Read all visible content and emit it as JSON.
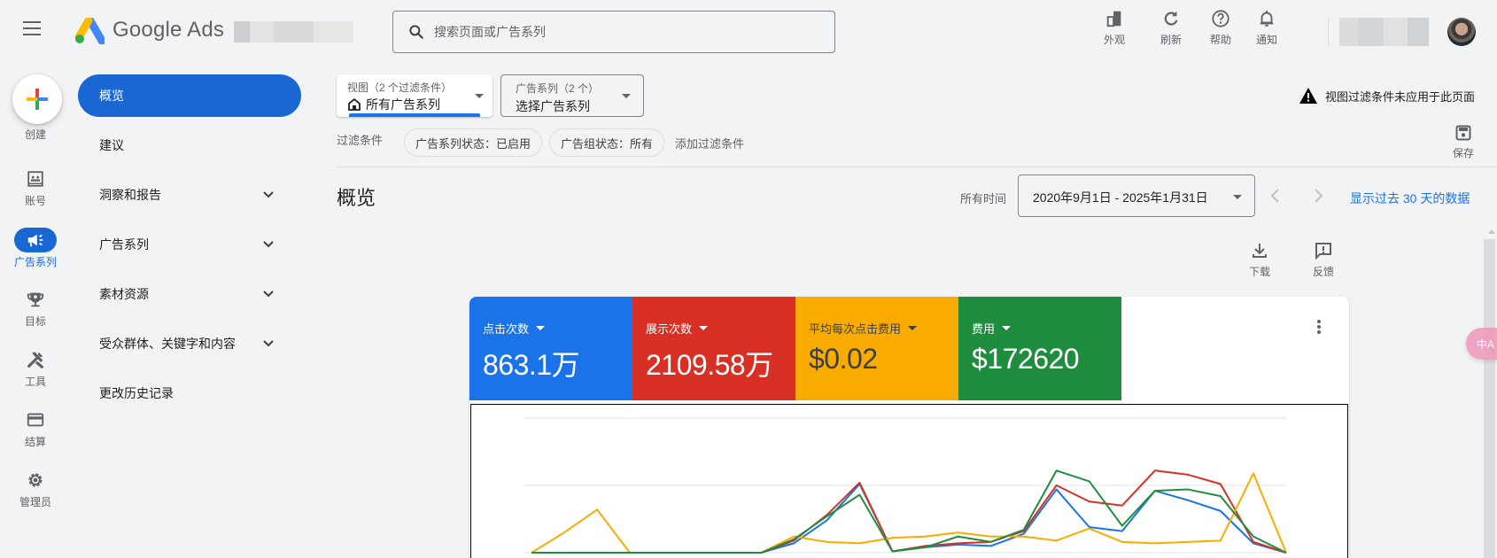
{
  "topbar": {
    "brand": "Google Ads",
    "search_placeholder": "搜索页面或广告系列",
    "actions": [
      {
        "icon": "appearance-icon",
        "label": "外观"
      },
      {
        "icon": "refresh-icon",
        "label": "刷新"
      },
      {
        "icon": "help-icon",
        "label": "帮助"
      },
      {
        "icon": "bell-icon",
        "label": "通知"
      }
    ]
  },
  "rail": {
    "create_label": "创建",
    "items": [
      {
        "icon": "account-icon",
        "label": "账号",
        "active": false
      },
      {
        "icon": "megaphone-icon",
        "label": "广告系列",
        "active": true
      },
      {
        "icon": "trophy-icon",
        "label": "目标",
        "active": false
      },
      {
        "icon": "tools-icon",
        "label": "工具",
        "active": false
      },
      {
        "icon": "billing-card-icon",
        "label": "结算",
        "active": false
      },
      {
        "icon": "gear-icon",
        "label": "管理员",
        "active": false
      }
    ]
  },
  "sidenav": {
    "items": [
      {
        "label": "概览",
        "active": true,
        "expandable": false
      },
      {
        "label": "建议",
        "active": false,
        "expandable": false
      },
      {
        "label": "洞察和报告",
        "active": false,
        "expandable": true
      },
      {
        "label": "广告系列",
        "active": false,
        "expandable": true
      },
      {
        "label": "素材资源",
        "active": false,
        "expandable": true
      },
      {
        "label": "受众群体、关键字和内容",
        "active": false,
        "expandable": true
      },
      {
        "label": "更改历史记录",
        "active": false,
        "expandable": false
      }
    ]
  },
  "filters": {
    "view_label": "视图（2 个过滤条件）",
    "view_value": "所有广告系列",
    "campaign_label": "广告系列（2 个）",
    "campaign_value": "选择广告系列",
    "filter_label": "过滤条件",
    "chips": [
      "广告系列状态：已启用",
      "广告组状态：所有"
    ],
    "add_filter": "添加过滤条件",
    "warning": "视图过滤条件未应用于此页面",
    "save_label": "保存"
  },
  "main": {
    "title": "概览",
    "time_label": "所有时间",
    "date_range": "2020年9月1日 - 2025年1月31日",
    "last30_link": "显示过去 30 天的数据",
    "download_label": "下载",
    "feedback_label": "反馈"
  },
  "metrics": [
    {
      "name": "点击次数",
      "value": "863.1万",
      "color": "#1a73e8",
      "text_color": "#ffffff"
    },
    {
      "name": "展示次数",
      "value": "2109.58万",
      "color": "#d93025",
      "text_color": "#ffffff"
    },
    {
      "name": "平均每次点击费用",
      "value": "$0.02",
      "color": "#f9ab00",
      "text_color": "#3c4043"
    },
    {
      "name": "费用",
      "value": "$172620",
      "color": "#1e8e3e",
      "text_color": "#ffffff"
    }
  ],
  "translate_label": "中A",
  "chart_data": {
    "type": "line",
    "title": "",
    "xlabel": "",
    "ylabel": "",
    "grid": true,
    "ylim": [
      0,
      100
    ],
    "note": "Values are normalized 0-100 per series (axes not labeled in view)",
    "x": [
      1,
      2,
      3,
      4,
      5,
      6,
      7,
      8,
      9,
      10,
      11,
      12,
      13,
      14,
      15,
      16,
      17,
      18,
      19,
      20,
      21,
      22,
      23,
      24
    ],
    "series": [
      {
        "name": "点击次数",
        "color": "#1a73e8",
        "values": [
          0,
          0,
          0,
          0,
          0,
          0,
          0,
          0,
          7,
          24,
          51,
          1,
          4,
          6,
          5,
          14,
          47,
          19,
          16,
          46,
          39,
          31,
          7,
          0
        ]
      },
      {
        "name": "展示次数",
        "color": "#d93025",
        "values": [
          0,
          0,
          0,
          0,
          0,
          0,
          0,
          0,
          9,
          28,
          52,
          1,
          5,
          7,
          8,
          16,
          50,
          38,
          35,
          61,
          58,
          51,
          8,
          0
        ]
      },
      {
        "name": "平均每次点击费用",
        "color": "#f9ab00",
        "values": [
          0,
          15,
          32,
          0,
          0,
          0,
          0,
          0,
          12,
          8,
          7,
          11,
          12,
          15,
          12,
          12,
          9,
          18,
          8,
          7,
          8,
          9,
          59,
          0
        ]
      },
      {
        "name": "费用",
        "color": "#1e8e3e",
        "values": [
          0,
          0,
          0,
          0,
          0,
          0,
          0,
          0,
          10,
          27,
          43,
          1,
          4,
          12,
          8,
          17,
          61,
          53,
          20,
          46,
          47,
          42,
          12,
          0
        ]
      }
    ]
  }
}
